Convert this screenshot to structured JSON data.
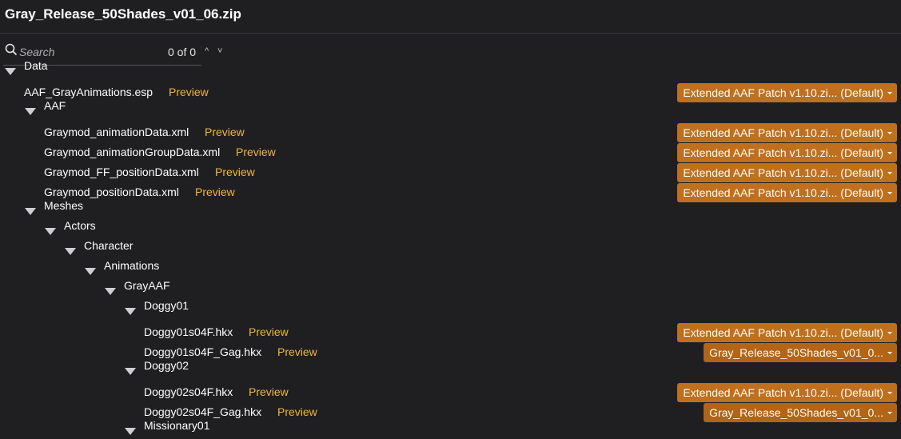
{
  "title": "Gray_Release_50Shades_v01_06.zip",
  "search": {
    "placeholder": "Search",
    "count": "0 of 0",
    "up": "^",
    "down": "˅"
  },
  "tree": [
    {
      "type": "folder",
      "depth": 0,
      "label": "Data"
    },
    {
      "type": "file",
      "depth": 1,
      "label": "AAF_GrayAnimations.esp",
      "preview": "Preview",
      "source": "Extended AAF Patch v1.10.zi... (Default)"
    },
    {
      "type": "folder",
      "depth": 1,
      "label": "AAF"
    },
    {
      "type": "file",
      "depth": 2,
      "label": "Graymod_animationData.xml",
      "preview": "Preview",
      "source": "Extended AAF Patch v1.10.zi... (Default)"
    },
    {
      "type": "file",
      "depth": 2,
      "label": "Graymod_animationGroupData.xml",
      "preview": "Preview",
      "source": "Extended AAF Patch v1.10.zi... (Default)"
    },
    {
      "type": "file",
      "depth": 2,
      "label": "Graymod_FF_positionData.xml",
      "preview": "Preview",
      "source": "Extended AAF Patch v1.10.zi... (Default)"
    },
    {
      "type": "file",
      "depth": 2,
      "label": "Graymod_positionData.xml",
      "preview": "Preview",
      "source": "Extended AAF Patch v1.10.zi... (Default)"
    },
    {
      "type": "folder",
      "depth": 1,
      "label": "Meshes"
    },
    {
      "type": "folder",
      "depth": 2,
      "label": "Actors"
    },
    {
      "type": "folder",
      "depth": 3,
      "label": "Character"
    },
    {
      "type": "folder",
      "depth": 4,
      "label": "Animations"
    },
    {
      "type": "folder",
      "depth": 5,
      "label": "GrayAAF"
    },
    {
      "type": "folder",
      "depth": 6,
      "label": "Doggy01"
    },
    {
      "type": "file",
      "depth": 7,
      "label": "Doggy01s04F.hkx",
      "preview": "Preview",
      "source": "Extended AAF Patch v1.10.zi... (Default)"
    },
    {
      "type": "file",
      "depth": 7,
      "label": "Doggy01s04F_Gag.hkx",
      "preview": "Preview",
      "source": "Gray_Release_50Shades_v01_0..."
    },
    {
      "type": "folder",
      "depth": 6,
      "label": "Doggy02"
    },
    {
      "type": "file",
      "depth": 7,
      "label": "Doggy02s04F.hkx",
      "preview": "Preview",
      "source": "Extended AAF Patch v1.10.zi... (Default)"
    },
    {
      "type": "file",
      "depth": 7,
      "label": "Doggy02s04F_Gag.hkx",
      "preview": "Preview",
      "source": "Gray_Release_50Shades_v01_0..."
    },
    {
      "type": "folder",
      "depth": 6,
      "label": "Missionary01"
    }
  ],
  "colors": {
    "background": "#1f1f22",
    "accent": "#c06f1c",
    "preview": "#f2b642"
  }
}
